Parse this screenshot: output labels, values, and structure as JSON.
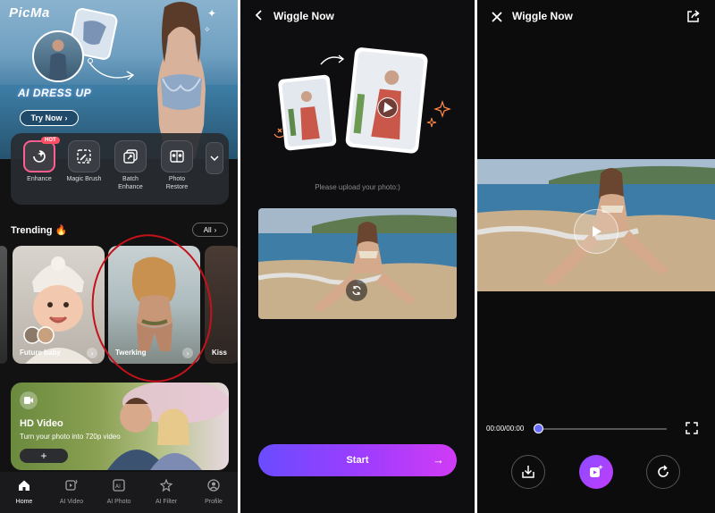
{
  "panel1": {
    "logo": "PicMa",
    "banner": {
      "title": "AI DRESS UP",
      "cta": "Try Now"
    },
    "tools": [
      {
        "label": "Enhance",
        "badge": "HOT",
        "icon": "sparkle-enhance-icon"
      },
      {
        "label": "Magic Brush",
        "icon": "magic-brush-icon"
      },
      {
        "label": "Batch Enhance",
        "icon": "batch-enhance-icon"
      },
      {
        "label": "Photo Restore",
        "icon": "photo-restore-icon"
      }
    ],
    "trending": {
      "title": "Trending 🔥",
      "all_label": "All"
    },
    "cards": [
      {
        "label": "Future baby"
      },
      {
        "label": "Twerking"
      },
      {
        "label": "Kiss"
      }
    ],
    "hd": {
      "title": "HD Video",
      "subtitle": "Turn your photo into 720p video",
      "button": "+"
    },
    "nav": [
      {
        "label": "Home",
        "icon": "home-icon"
      },
      {
        "label": "AI Video",
        "icon": "ai-video-icon"
      },
      {
        "label": "AI Photo",
        "icon": "ai-photo-icon"
      },
      {
        "label": "AI Filter",
        "icon": "ai-filter-icon"
      },
      {
        "label": "Profile",
        "icon": "profile-icon"
      }
    ]
  },
  "panel2": {
    "title": "Wiggle Now",
    "hint": "Please upload your photo:)",
    "start_label": "Start",
    "start_arrow": "→"
  },
  "panel3": {
    "title": "Wiggle Now",
    "time": "00:00/00:00",
    "progress": 0,
    "accent": "#6a6cff"
  }
}
